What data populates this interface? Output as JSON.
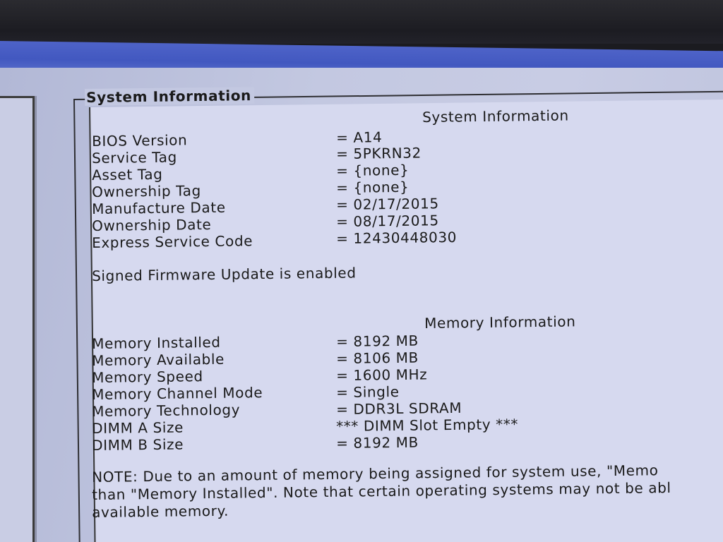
{
  "frame_title": "System Information",
  "system_info": {
    "heading": "System Information",
    "rows": [
      {
        "label": "BIOS Version",
        "value": "= A14"
      },
      {
        "label": "Service Tag",
        "value": "= 5PKRN32"
      },
      {
        "label": "Asset Tag",
        "value": "= {none}"
      },
      {
        "label": "Ownership Tag",
        "value": "= {none}"
      },
      {
        "label": "Manufacture Date",
        "value": "= 02/17/2015"
      },
      {
        "label": "Ownership Date",
        "value": "= 08/17/2015"
      },
      {
        "label": "Express Service Code",
        "value": "= 12430448030"
      }
    ],
    "firmware_note": "Signed Firmware Update is enabled"
  },
  "memory_info": {
    "heading": "Memory Information",
    "rows": [
      {
        "label": "Memory Installed",
        "value": "= 8192 MB"
      },
      {
        "label": "Memory Available",
        "value": "= 8106 MB"
      },
      {
        "label": "Memory Speed",
        "value": "= 1600 MHz"
      },
      {
        "label": "Memory Channel Mode",
        "value": "= Single"
      },
      {
        "label": "Memory Technology",
        "value": "= DDR3L SDRAM"
      },
      {
        "label": "DIMM A Size",
        "value": "*** DIMM Slot Empty ***"
      },
      {
        "label": "DIMM B Size",
        "value": "= 8192 MB"
      }
    ]
  },
  "note": {
    "line1": "NOTE: Due to an amount of memory being assigned for system use, \"Memo",
    "line2": "than \"Memory Installed\". Note that certain operating systems may not be abl",
    "line3": "available memory."
  },
  "colors": {
    "title_bar": "#4258c0",
    "background": "#c3c8e1",
    "text": "#1a1a1a"
  }
}
